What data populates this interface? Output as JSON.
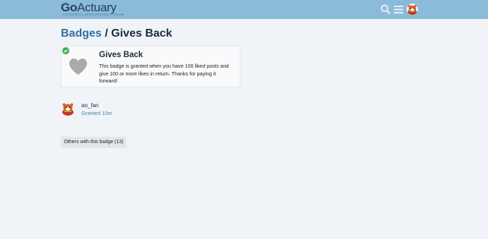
{
  "header": {
    "logo_go": "Go",
    "logo_actuary": "Actuary",
    "logo_tagline": "ACTUARIAL DISCUSSION FORUM",
    "icons": [
      "search-icon",
      "hamburger-menu-icon",
      "user-avatar"
    ]
  },
  "title": {
    "breadcrumb": "Badges",
    "separator": "/",
    "current": "Gives Back"
  },
  "badge": {
    "name": "Gives Back",
    "description": "This badge is granted when you have 100 liked posts and give 100 or more likes in return. Thanks for paying it forward!",
    "icon": "heart-icon",
    "granted_indicator": "check-circle-icon"
  },
  "grant": {
    "username": "ao_fan",
    "granted_text": "Granted 10m"
  },
  "others_button": {
    "label": "Others with this badge (13)"
  },
  "colors": {
    "header_bg": "#8bbbd8",
    "page_bg": "#f0f4f8",
    "link": "#2f6f9f",
    "check_green": "#3fae4a",
    "heart_gray": "#aaaaaa"
  }
}
